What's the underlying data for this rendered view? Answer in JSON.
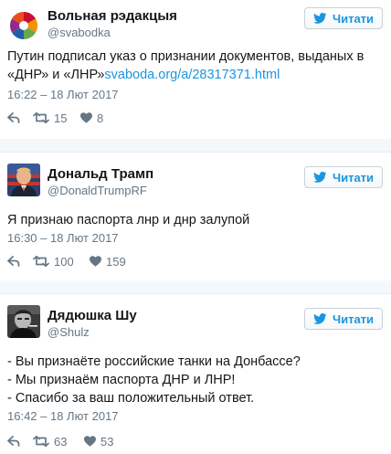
{
  "follow_label": "Читати",
  "tweets": [
    {
      "name": "Вольная рэдакцыя",
      "handle": "@svabodka",
      "text_line1": "Путин подписал указ о признании документов, выданых в",
      "text_line2_plain": "«ДНР» и «ЛНР»",
      "link": "svaboda.org/a/28317371.html",
      "time": "16:22 – 18 Лют 2017",
      "retweets": "15",
      "likes": "8",
      "avatar_colors": [
        "#c8102e",
        "#f39200",
        "#1f5fa9",
        "#6aa84f"
      ]
    },
    {
      "name": "Дональд Трамп",
      "handle": "@DonaldTrumpRF",
      "text_line1": "Я признаю паспорта лнр и днр залупой",
      "time": "16:30 – 18 Лют 2017",
      "retweets": "100",
      "likes": "159"
    },
    {
      "name": "Дядюшка Шу",
      "handle": "@Shulz",
      "lines": [
        "- Вы признаёте российские танки на Донбассе?",
        "- Мы признаём паспорта ДНР и ЛНР!",
        "- Спасибо за ваш положительный ответ."
      ],
      "time": "16:42 – 18 Лют 2017",
      "retweets": "63",
      "likes": "53"
    }
  ],
  "icons": {
    "follow": "twitter-bird-icon",
    "reply": "reply-icon",
    "retweet": "retweet-icon",
    "like": "heart-icon"
  },
  "colors": {
    "link": "#1b95e0",
    "meta": "#657786",
    "separator": "#f5f8fa"
  }
}
